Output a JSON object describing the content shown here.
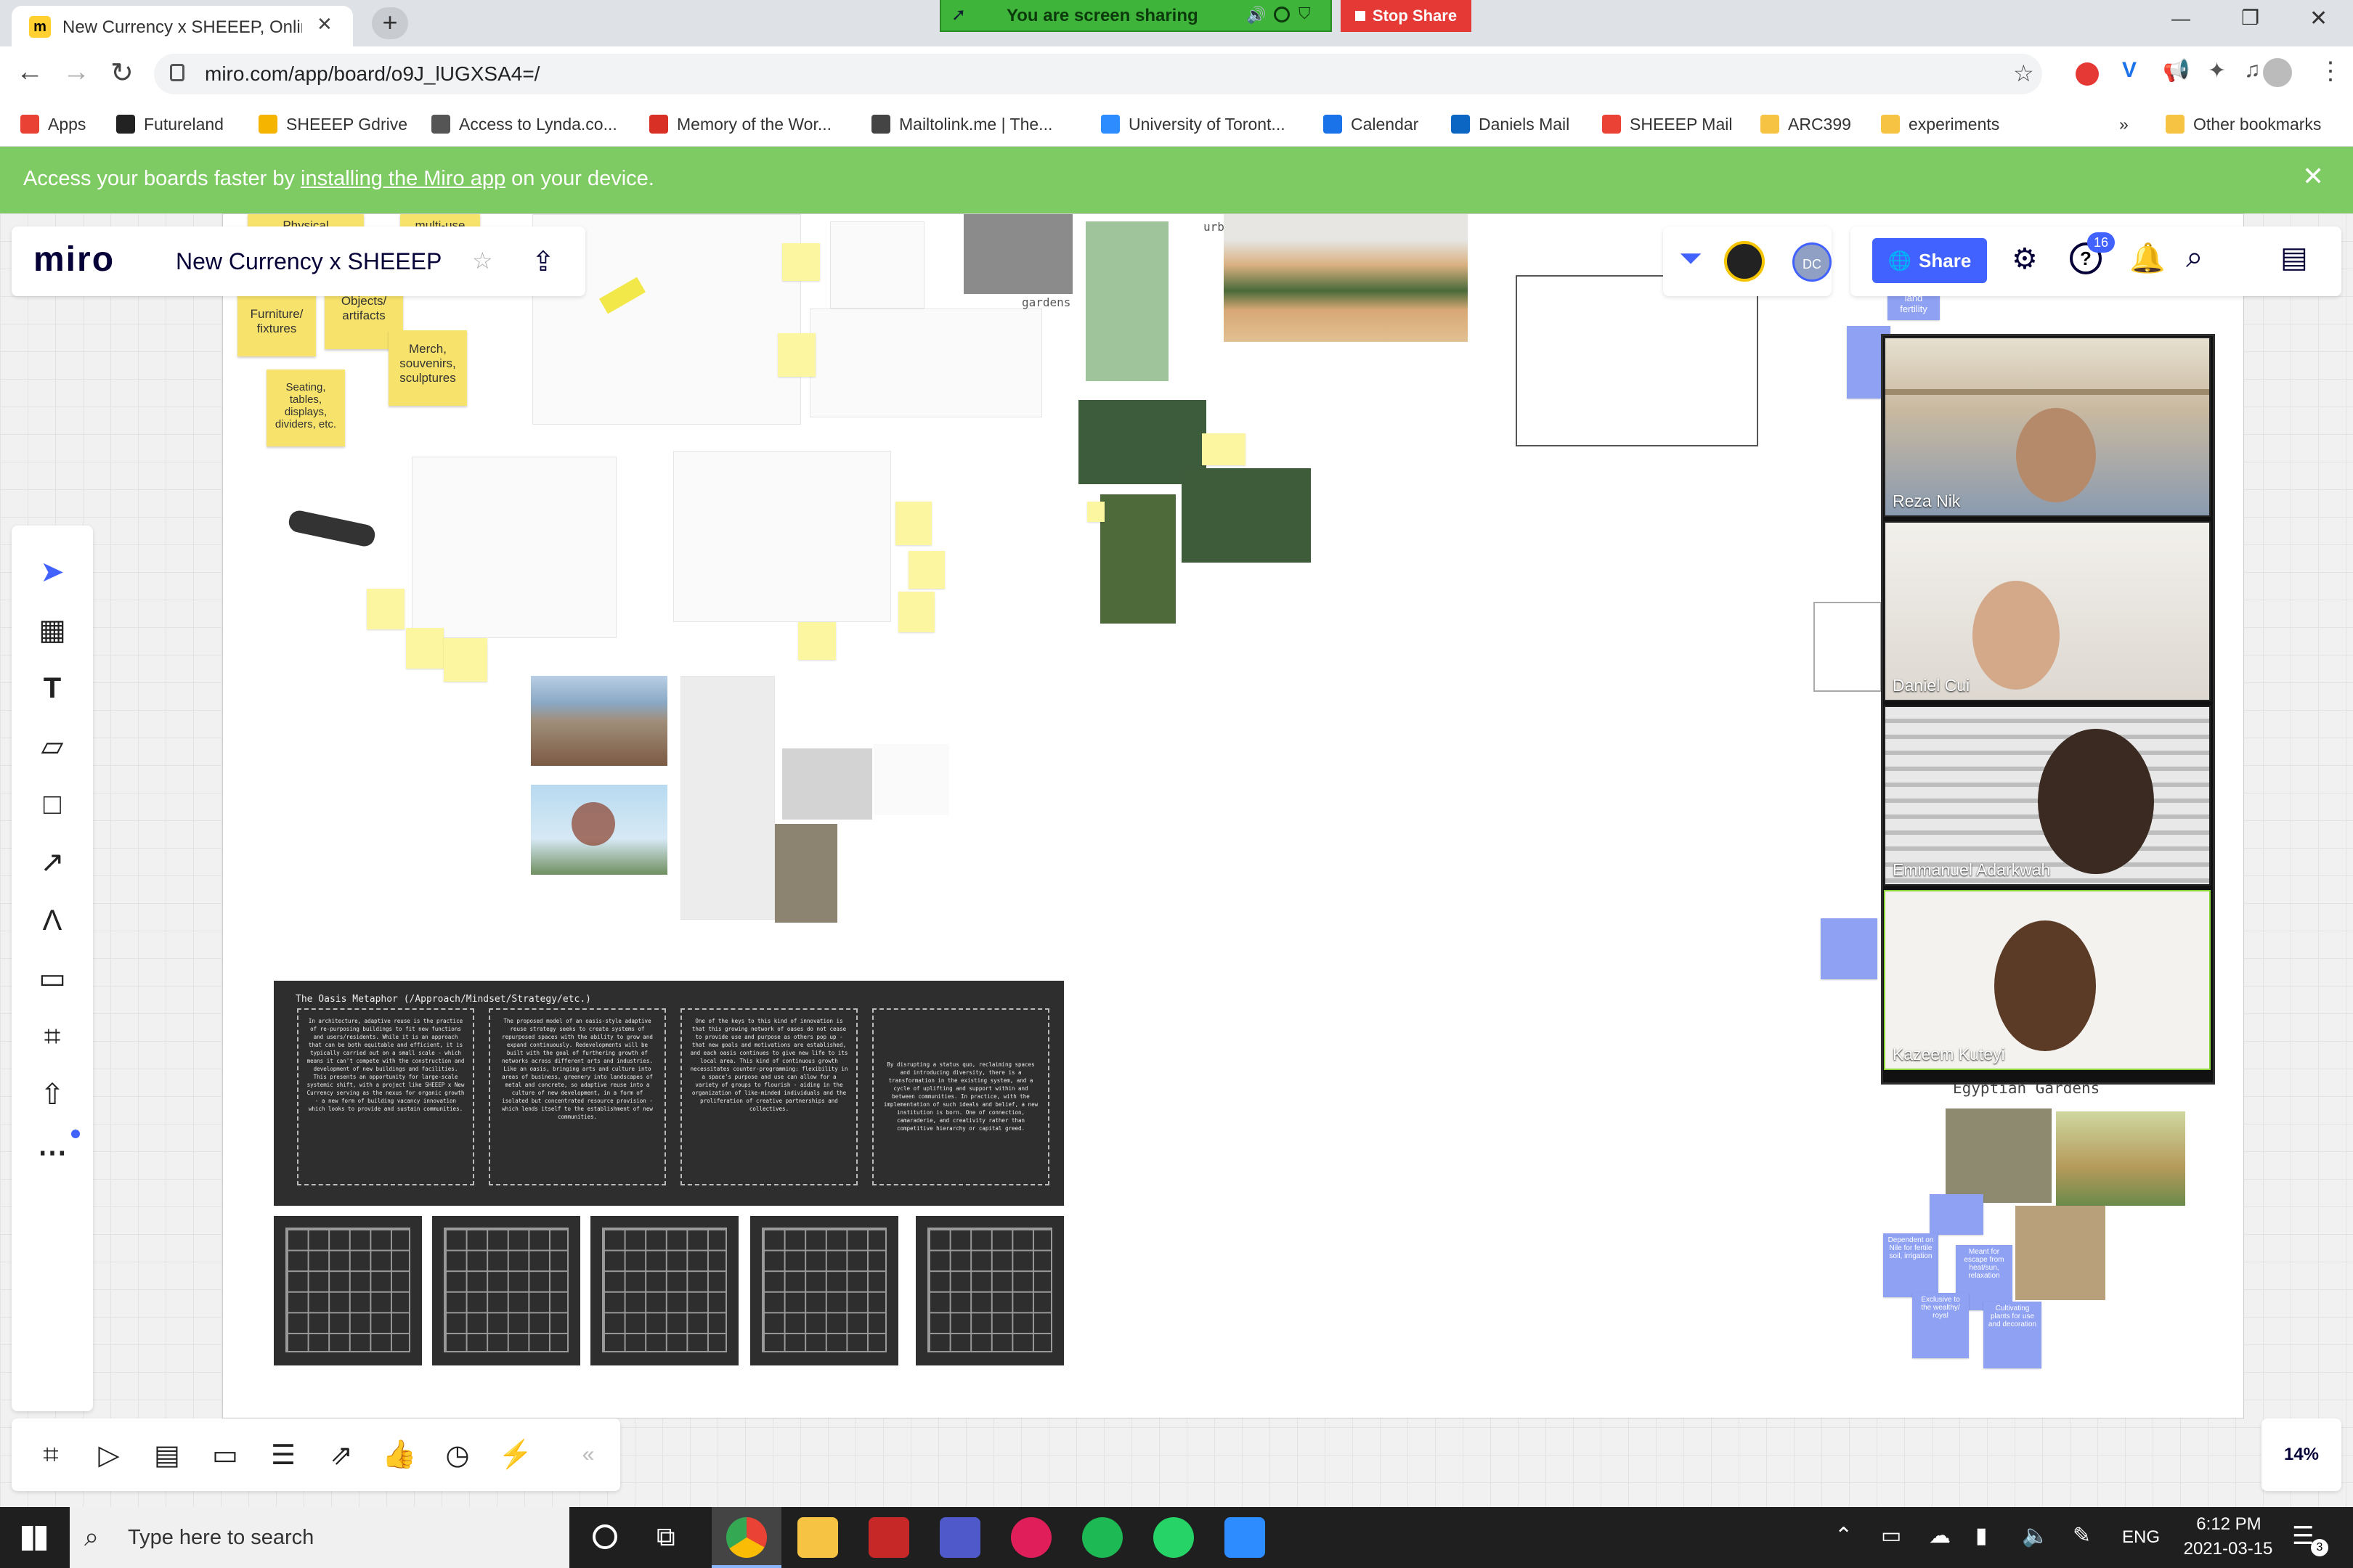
{
  "browser": {
    "tab_title": "New Currency x SHEEEP, Online W",
    "new_tab": "+",
    "url": "miro.com/app/board/o9J_lUGXSA4=/",
    "window_controls": {
      "minimize": "—",
      "maximize": "❐",
      "close": "✕"
    }
  },
  "sharing": {
    "status": "You are screen sharing",
    "stop_label": "Stop Share"
  },
  "bookmarks": [
    {
      "label": "Apps",
      "color": "#e94235"
    },
    {
      "label": "Futureland",
      "color": "#222222"
    },
    {
      "label": "SHEEEP Gdrive",
      "color": "#f4b400"
    },
    {
      "label": "Access to Lynda.co...",
      "color": "#555555"
    },
    {
      "label": "Memory of the Wor...",
      "color": "#d93025"
    },
    {
      "label": "Mailtolink.me | The...",
      "color": "#444444"
    },
    {
      "label": "University of Toront...",
      "color": "#2d8cff"
    },
    {
      "label": "Calendar",
      "color": "#1a73e8"
    },
    {
      "label": "Daniels Mail",
      "color": "#0a66c2"
    },
    {
      "label": "SHEEEP Mail",
      "color": "#ea4335"
    },
    {
      "label": "ARC399",
      "color": "#f6c343"
    },
    {
      "label": "experiments",
      "color": "#f6c343"
    }
  ],
  "bookmarks_more": "»",
  "bookmarks_other": "Other bookmarks",
  "banner": {
    "prefix": "Access your boards faster by ",
    "link": "installing the Miro app",
    "suffix": " on your device.",
    "close": "✕"
  },
  "miro": {
    "logo": "miro",
    "board_title": "New Currency x SHEEEP",
    "avatar_initials": "DC",
    "share_label": "Share",
    "notification_count": "16",
    "zoom": "14%"
  },
  "stickies_yellow": [
    "Physical",
    "multi-use",
    "Furniture/ fixtures",
    "Objects/ artifacts",
    "Merch, souvenirs, sculptures",
    "Seating, tables, displays, dividers, etc."
  ],
  "board_labels": {
    "gardens": "gardens",
    "urban_oasis": "urban oasis",
    "egyptian_gardens": "Egyptian Gardens",
    "land_fertility": "land fertility"
  },
  "oasis_panel": {
    "title": "The Oasis Metaphor (/Approach/Mindset/Strategy/etc.)",
    "columns": [
      "In architecture, adaptive reuse is the practice of re-purposing buildings to fit new functions and users/residents. While it is an approach that can be both equitable and efficient, it is typically carried out on a small scale - which means it can't compete with the construction and development of new buildings and facilities. This presents an opportunity for large-scale systemic shift, with a project like SHEEEP x New Currency serving as the nexus for organic growth - a new form of building vacancy innovation which looks to provide and sustain communities.",
      "The proposed model of an oasis-style adaptive reuse strategy seeks to create systems of repurposed spaces with the ability to grow and expand continuously. Redevelopments will be built with the goal of furthering growth of networks across different arts and industries. Like an oasis, bringing arts and culture into areas of business, greenery into landscapes of metal and concrete, so adaptive reuse into a culture of new development, in a form of isolated but concentrated resource provision - which lends itself to the establishment of new communities.",
      "One of the keys to this kind of innovation is that this growing network of oases do not cease to provide use and purpose as others pop up - that new goals and motivations are established, and each oasis continues to give new life to its local area. This kind of continuous growth necessitates counter-programming: flexibility in a space's purpose and use can allow for a variety of groups to flourish - aiding in the organization of like-minded individuals and the proliferation of creative partnerships and collectives.",
      "By disrupting a status quo, reclaiming spaces and introducing diversity, there is a transformation in the existing system, and a cycle of uplifting and support within and between communities. In practice, with the implementation of such ideals and belief, a new institution is born. One of connection, camaraderie, and creativity rather than competitive hierarchy or capital greed."
    ]
  },
  "egypt_stickies": [
    "Dependent on Nile for fertile soil, irrigation",
    "Meant for escape from heat/sun, relaxation",
    "Exclusive to the wealthy/ royal",
    "Cultivating plants for use and decoration"
  ],
  "participants": [
    {
      "name": "Reza Nik"
    },
    {
      "name": "Daniel Cui"
    },
    {
      "name": "Emmanuel Adarkwah"
    },
    {
      "name": "Kazeem Kuteyi"
    }
  ],
  "taskbar": {
    "search_placeholder": "Type here to search",
    "language": "ENG",
    "time": "6:12 PM",
    "date": "2021-03-15",
    "notif_badge": "3"
  }
}
